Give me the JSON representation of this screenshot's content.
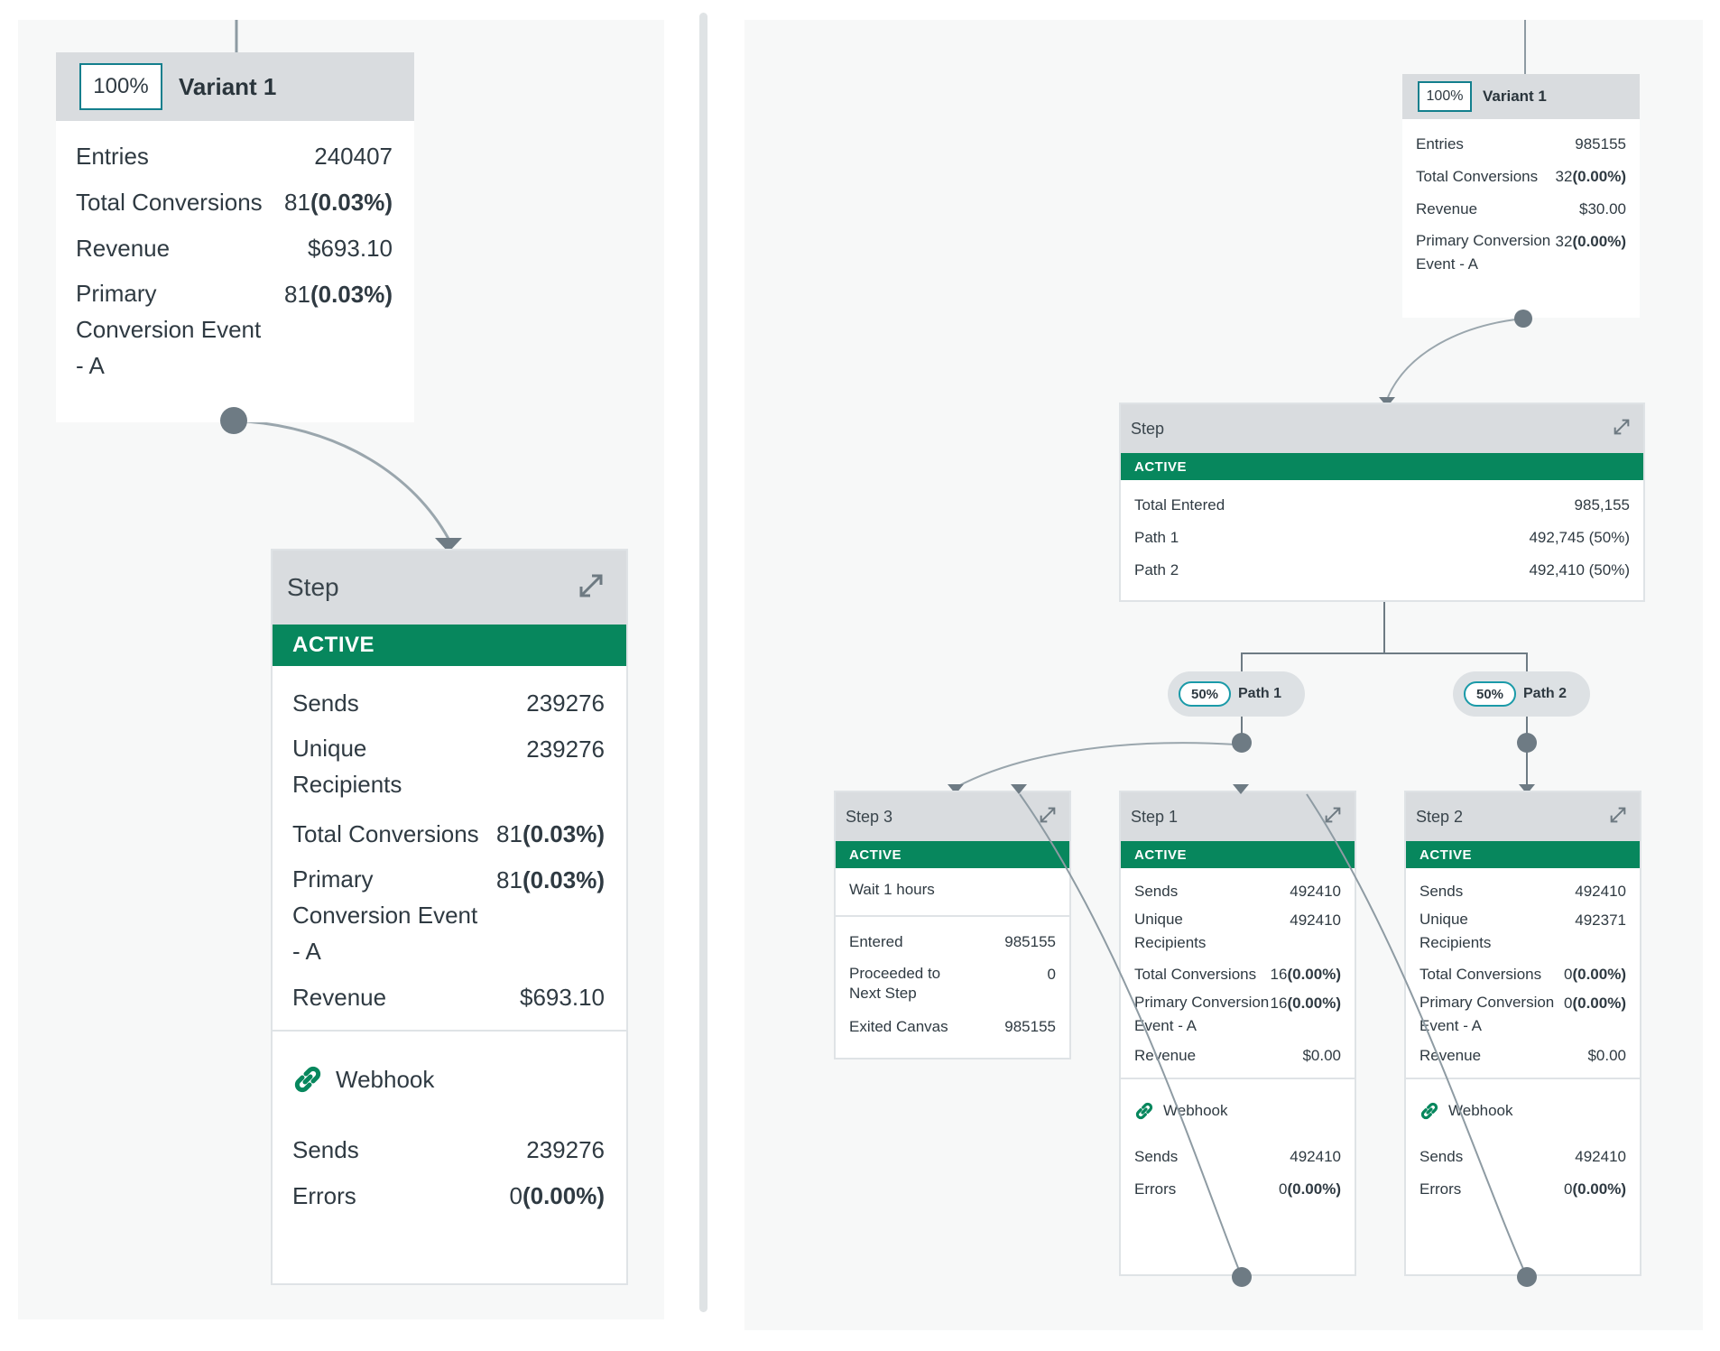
{
  "left": {
    "variant": {
      "pct": "100%",
      "title": "Variant 1",
      "rows": [
        {
          "label": "Entries",
          "num": "240407",
          "pct": ""
        },
        {
          "label": "Total Conversions",
          "num": "81",
          "pct": "(0.03%)"
        },
        {
          "label": "Revenue",
          "num": "$693.10",
          "pct": ""
        },
        {
          "label": "Primary Conversion Event - A",
          "num": "81",
          "pct": "(0.03%)"
        }
      ]
    },
    "step": {
      "title": "Step",
      "status": "ACTIVE",
      "rows": [
        {
          "label": "Sends",
          "num": "239276",
          "pct": ""
        },
        {
          "label": "Unique Recipients",
          "num": "239276",
          "pct": ""
        },
        {
          "label": "Total Conversions",
          "num": "81",
          "pct": "(0.03%)"
        },
        {
          "label": "Primary Conversion Event - A",
          "num": "81",
          "pct": "(0.03%)"
        },
        {
          "label": "Revenue",
          "num": "$693.10",
          "pct": ""
        }
      ],
      "webhook": {
        "title": "Webhook",
        "rows": [
          {
            "label": "Sends",
            "num": "239276",
            "pct": ""
          },
          {
            "label": "Errors",
            "num": "0",
            "pct": "(0.00%)"
          }
        ]
      }
    }
  },
  "right": {
    "variant": {
      "pct": "100%",
      "title": "Variant 1",
      "rows": [
        {
          "label": "Entries",
          "num": "985155",
          "pct": ""
        },
        {
          "label": "Total Conversions",
          "num": "32",
          "pct": "(0.00%)"
        },
        {
          "label": "Revenue",
          "num": "$30.00",
          "pct": ""
        },
        {
          "label": "Primary Conversion Event - A",
          "num": "32",
          "pct": "(0.00%)"
        }
      ]
    },
    "split": {
      "title": "Step",
      "status": "ACTIVE",
      "rows": [
        {
          "label": "Total Entered",
          "num": "985,155",
          "pct": ""
        },
        {
          "label": "Path 1",
          "num": "492,745 (50%)",
          "pct": ""
        },
        {
          "label": "Path 2",
          "num": "492,410 (50%)",
          "pct": ""
        }
      ]
    },
    "paths": [
      {
        "pct": "50%",
        "label": "Path 1"
      },
      {
        "pct": "50%",
        "label": "Path 2"
      }
    ],
    "step3": {
      "title": "Step 3",
      "status": "ACTIVE",
      "wait": "Wait 1 hours",
      "rows": [
        {
          "label": "Entered",
          "num": "985155",
          "pct": ""
        },
        {
          "label": "Proceeded to Next Step",
          "num": "0",
          "pct": ""
        },
        {
          "label": "Exited Canvas",
          "num": "985155",
          "pct": ""
        }
      ]
    },
    "step1": {
      "title": "Step 1",
      "status": "ACTIVE",
      "rows": [
        {
          "label": "Sends",
          "num": "492410",
          "pct": ""
        },
        {
          "label": "Unique Recipients",
          "num": "492410",
          "pct": ""
        },
        {
          "label": "Total Conversions",
          "num": "16",
          "pct": "(0.00%)"
        },
        {
          "label": "Primary Conversion Event - A",
          "num": "16",
          "pct": "(0.00%)"
        },
        {
          "label": "Revenue",
          "num": "$0.00",
          "pct": ""
        }
      ],
      "webhook": {
        "title": "Webhook",
        "rows": [
          {
            "label": "Sends",
            "num": "492410",
            "pct": ""
          },
          {
            "label": "Errors",
            "num": "0",
            "pct": "(0.00%)"
          }
        ]
      }
    },
    "step2": {
      "title": "Step 2",
      "status": "ACTIVE",
      "rows": [
        {
          "label": "Sends",
          "num": "492410",
          "pct": ""
        },
        {
          "label": "Unique Recipients",
          "num": "492371",
          "pct": ""
        },
        {
          "label": "Total Conversions",
          "num": "0",
          "pct": "(0.00%)"
        },
        {
          "label": "Primary Conversion Event - A",
          "num": "0",
          "pct": "(0.00%)"
        },
        {
          "label": "Revenue",
          "num": "$0.00",
          "pct": ""
        }
      ],
      "webhook": {
        "title": "Webhook",
        "rows": [
          {
            "label": "Sends",
            "num": "492410",
            "pct": ""
          },
          {
            "label": "Errors",
            "num": "0",
            "pct": "(0.00%)"
          }
        ]
      }
    }
  },
  "colors": {
    "active": "#07875d",
    "accent": "#137f8d",
    "connector": "#8e9ba3",
    "node": "#6e7b84",
    "header": "#d9dcdf"
  },
  "icons": {
    "expand": "expand-icon",
    "webhook": "link-icon",
    "connector-node": "node-dot"
  }
}
